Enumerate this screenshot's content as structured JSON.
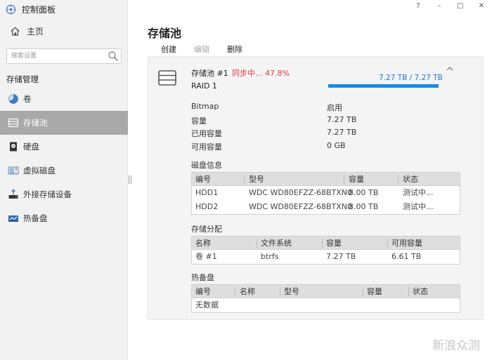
{
  "app": {
    "title": "控制面板",
    "home": "主页"
  },
  "window_controls": {
    "help": "?",
    "minimize": "–",
    "maximize": "□",
    "close": "✕"
  },
  "sidebar": {
    "search_placeholder": "搜索设置",
    "section_title": "存储管理",
    "items": [
      {
        "label": "卷",
        "icon": "volume-pie-icon"
      },
      {
        "label": "存储池",
        "icon": "storage-pool-icon",
        "active": true
      },
      {
        "label": "硬盘",
        "icon": "hard-disk-icon"
      },
      {
        "label": "虚拟磁盘",
        "icon": "virtual-disk-icon"
      },
      {
        "label": "外接存储设备",
        "icon": "external-storage-icon"
      },
      {
        "label": "热备盘",
        "icon": "hot-spare-icon"
      }
    ]
  },
  "main": {
    "title": "存储池",
    "toolbar": {
      "create": "创建",
      "edit": "编辑",
      "delete": "删除"
    },
    "pool": {
      "name": "存储池 #1",
      "status": "同步中... 47.8%",
      "sync_progress": 0.478,
      "raid": "RAID 1",
      "capacity_text": "7.27 TB / 7.27 TB",
      "usage_fraction": 1.0,
      "accent_color": "#1a88e8",
      "status_color": "#e23a3a",
      "properties": [
        {
          "key": "Bitmap",
          "value": "启用"
        },
        {
          "key": "容量",
          "value": "7.27 TB"
        },
        {
          "key": "已用容量",
          "value": "7.27 TB"
        },
        {
          "key": "可用容量",
          "value": "0 GB"
        }
      ]
    },
    "disk_info": {
      "title": "磁盘信息",
      "columns": [
        "编号",
        "型号",
        "容量",
        "状态"
      ],
      "rows": [
        [
          "HDD1",
          "WDC WD80EFZZ-68BTXN0",
          "8.00 TB",
          "测试中..."
        ],
        [
          "HDD2",
          "WDC WD80EFZZ-68BTXN0",
          "8.00 TB",
          "测试中..."
        ]
      ]
    },
    "allocation": {
      "title": "存储分配",
      "columns": [
        "名称",
        "文件系统",
        "容量",
        "可用容量"
      ],
      "rows": [
        [
          "卷 #1",
          "btrfs",
          "7.27 TB",
          "6.61 TB"
        ]
      ]
    },
    "hot_spare": {
      "title": "热备盘",
      "columns": [
        "编号",
        "名称",
        "型号",
        "容量",
        "状态"
      ],
      "empty": "无数据"
    }
  },
  "watermark": {
    "text": "新浪众测"
  }
}
